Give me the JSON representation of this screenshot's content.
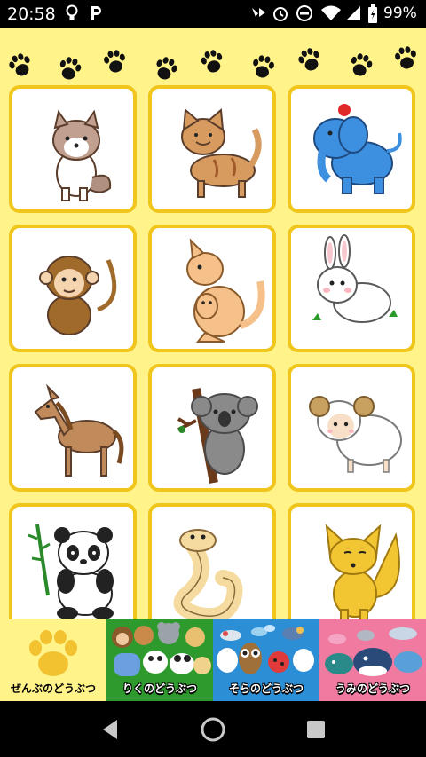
{
  "status": {
    "time": "20:58",
    "left_icons": [
      "bulb-icon",
      "p-app-icon"
    ],
    "right_icons": [
      "wifi-icon",
      "alarm-icon",
      "dnd-icon",
      "signal-icon",
      "battery-icon"
    ],
    "battery_text": "99%"
  },
  "colors": {
    "background": "#fff38a",
    "card_border": "#f0c51c",
    "tab_all": "#fff38a",
    "tab_land": "#2e9a2e",
    "tab_sky": "#2c8fd6",
    "tab_sea": "#f07aa0"
  },
  "grid": {
    "animals": [
      {
        "name": "dog-icon"
      },
      {
        "name": "cat-icon"
      },
      {
        "name": "elephant-icon"
      },
      {
        "name": "monkey-icon"
      },
      {
        "name": "kangaroo-icon"
      },
      {
        "name": "rabbit-icon"
      },
      {
        "name": "horse-icon"
      },
      {
        "name": "koala-icon"
      },
      {
        "name": "sheep-icon"
      },
      {
        "name": "panda-icon"
      },
      {
        "name": "snake-icon"
      },
      {
        "name": "fox-icon"
      }
    ]
  },
  "tabs": [
    {
      "label": "ぜんぶのどうぶつ",
      "icon": "paw-icon"
    },
    {
      "label": "りくのどうぶつ",
      "icon": "land-animals-icon"
    },
    {
      "label": "そらのどうぶつ",
      "icon": "sky-animals-icon"
    },
    {
      "label": "うみのどうぶつ",
      "icon": "sea-animals-icon"
    }
  ],
  "nav": {
    "icons": [
      "back-icon",
      "home-icon",
      "recents-icon"
    ]
  }
}
